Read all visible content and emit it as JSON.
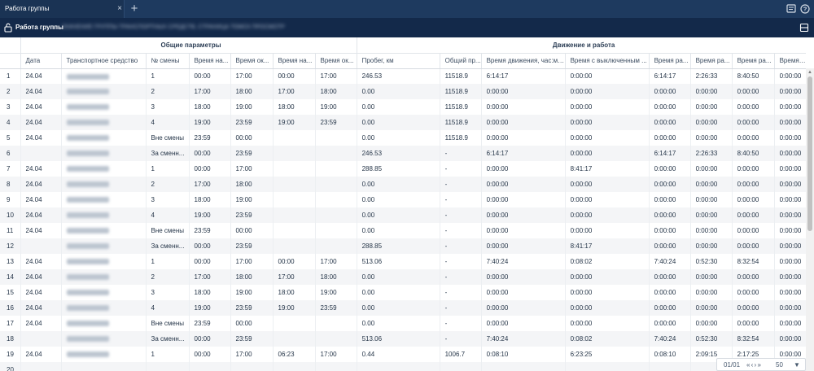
{
  "tab": {
    "title": "Работа группы",
    "close_glyph": "×",
    "add_glyph": "+"
  },
  "toolbar_icons": [
    "comment-icon",
    "help-icon"
  ],
  "subheader": {
    "title": "Работа группы",
    "path_text": "ЗНАЧЕНИЕ ГРУППЫ ТРАНСПОРТНЫХ СРЕДСТВ, СТРАНИЦА ТОМСК ПРОСМОТР",
    "right_icon": "layout-icon"
  },
  "groups": {
    "common": "Общие параметры",
    "movement": "Движение и работа"
  },
  "columns": [
    "",
    "Дата",
    "Транспортное средство",
    "№ смены",
    "Время на...",
    "Время ок...",
    "Время на...",
    "Время ок...",
    "Пробег, км",
    "Общий пр...",
    "Время движения, час:ми...",
    "Время с выключенным ...",
    "Время ра...",
    "Время ра...",
    "Время ра...",
    "Время ра..."
  ],
  "rows": [
    [
      "1",
      "24.04",
      "",
      "1",
      "00:00",
      "17:00",
      "00:00",
      "17:00",
      "246.53",
      "11518.9",
      "6:14:17",
      "0:00:00",
      "6:14:17",
      "2:26:33",
      "8:40:50",
      "0:00:00"
    ],
    [
      "2",
      "24.04",
      "",
      "2",
      "17:00",
      "18:00",
      "17:00",
      "18:00",
      "0.00",
      "11518.9",
      "0:00:00",
      "0:00:00",
      "0:00:00",
      "0:00:00",
      "0:00:00",
      "0:00:00"
    ],
    [
      "3",
      "24.04",
      "",
      "3",
      "18:00",
      "19:00",
      "18:00",
      "19:00",
      "0.00",
      "11518.9",
      "0:00:00",
      "0:00:00",
      "0:00:00",
      "0:00:00",
      "0:00:00",
      "0:00:00"
    ],
    [
      "4",
      "24.04",
      "",
      "4",
      "19:00",
      "23:59",
      "19:00",
      "23:59",
      "0.00",
      "11518.9",
      "0:00:00",
      "0:00:00",
      "0:00:00",
      "0:00:00",
      "0:00:00",
      "0:00:00"
    ],
    [
      "5",
      "24.04",
      "",
      "Вне смены",
      "23:59",
      "00:00",
      "",
      "",
      "0.00",
      "11518.9",
      "0:00:00",
      "0:00:00",
      "0:00:00",
      "0:00:00",
      "0:00:00",
      "0:00:00"
    ],
    [
      "6",
      "",
      "",
      "За сменн...",
      "00:00",
      "23:59",
      "",
      "",
      "246.53",
      "-",
      "6:14:17",
      "0:00:00",
      "6:14:17",
      "2:26:33",
      "8:40:50",
      "0:00:00"
    ],
    [
      "7",
      "24.04",
      "",
      "1",
      "00:00",
      "17:00",
      "",
      "",
      "288.85",
      "-",
      "0:00:00",
      "8:41:17",
      "0:00:00",
      "0:00:00",
      "0:00:00",
      "0:00:00"
    ],
    [
      "8",
      "24.04",
      "",
      "2",
      "17:00",
      "18:00",
      "",
      "",
      "0.00",
      "-",
      "0:00:00",
      "0:00:00",
      "0:00:00",
      "0:00:00",
      "0:00:00",
      "0:00:00"
    ],
    [
      "9",
      "24.04",
      "",
      "3",
      "18:00",
      "19:00",
      "",
      "",
      "0.00",
      "-",
      "0:00:00",
      "0:00:00",
      "0:00:00",
      "0:00:00",
      "0:00:00",
      "0:00:00"
    ],
    [
      "10",
      "24.04",
      "",
      "4",
      "19:00",
      "23:59",
      "",
      "",
      "0.00",
      "-",
      "0:00:00",
      "0:00:00",
      "0:00:00",
      "0:00:00",
      "0:00:00",
      "0:00:00"
    ],
    [
      "11",
      "24.04",
      "",
      "Вне смены",
      "23:59",
      "00:00",
      "",
      "",
      "0.00",
      "-",
      "0:00:00",
      "0:00:00",
      "0:00:00",
      "0:00:00",
      "0:00:00",
      "0:00:00"
    ],
    [
      "12",
      "",
      "",
      "За сменн...",
      "00:00",
      "23:59",
      "",
      "",
      "288.85",
      "-",
      "0:00:00",
      "8:41:17",
      "0:00:00",
      "0:00:00",
      "0:00:00",
      "0:00:00"
    ],
    [
      "13",
      "24.04",
      "",
      "1",
      "00:00",
      "17:00",
      "00:00",
      "17:00",
      "513.06",
      "-",
      "7:40:24",
      "0:08:02",
      "7:40:24",
      "0:52:30",
      "8:32:54",
      "0:00:00"
    ],
    [
      "14",
      "24.04",
      "",
      "2",
      "17:00",
      "18:00",
      "17:00",
      "18:00",
      "0.00",
      "-",
      "0:00:00",
      "0:00:00",
      "0:00:00",
      "0:00:00",
      "0:00:00",
      "0:00:00"
    ],
    [
      "15",
      "24.04",
      "",
      "3",
      "18:00",
      "19:00",
      "18:00",
      "19:00",
      "0.00",
      "-",
      "0:00:00",
      "0:00:00",
      "0:00:00",
      "0:00:00",
      "0:00:00",
      "0:00:00"
    ],
    [
      "16",
      "24.04",
      "",
      "4",
      "19:00",
      "23:59",
      "19:00",
      "23:59",
      "0.00",
      "-",
      "0:00:00",
      "0:00:00",
      "0:00:00",
      "0:00:00",
      "0:00:00",
      "0:00:00"
    ],
    [
      "17",
      "24.04",
      "",
      "Вне смены",
      "23:59",
      "00:00",
      "",
      "",
      "0.00",
      "-",
      "0:00:00",
      "0:00:00",
      "0:00:00",
      "0:00:00",
      "0:00:00",
      "0:00:00"
    ],
    [
      "18",
      "",
      "",
      "За сменн...",
      "00:00",
      "23:59",
      "",
      "",
      "513.06",
      "-",
      "7:40:24",
      "0:08:02",
      "7:40:24",
      "0:52:30",
      "8:32:54",
      "0:00:00"
    ],
    [
      "19",
      "24.04",
      "",
      "1",
      "00:00",
      "17:00",
      "06:23",
      "17:00",
      "0.44",
      "1006.7",
      "0:08:10",
      "6:23:25",
      "0:08:10",
      "2:09:15",
      "2:17:25",
      "0:00:00"
    ],
    [
      "20",
      "",
      "",
      "",
      "",
      "",
      "",
      "",
      "",
      "",
      "",
      "",
      "",
      "",
      "",
      ""
    ]
  ],
  "pager": {
    "page": "01/01",
    "nav": "« ‹ › »",
    "size": "50",
    "dropdown": "▼"
  }
}
